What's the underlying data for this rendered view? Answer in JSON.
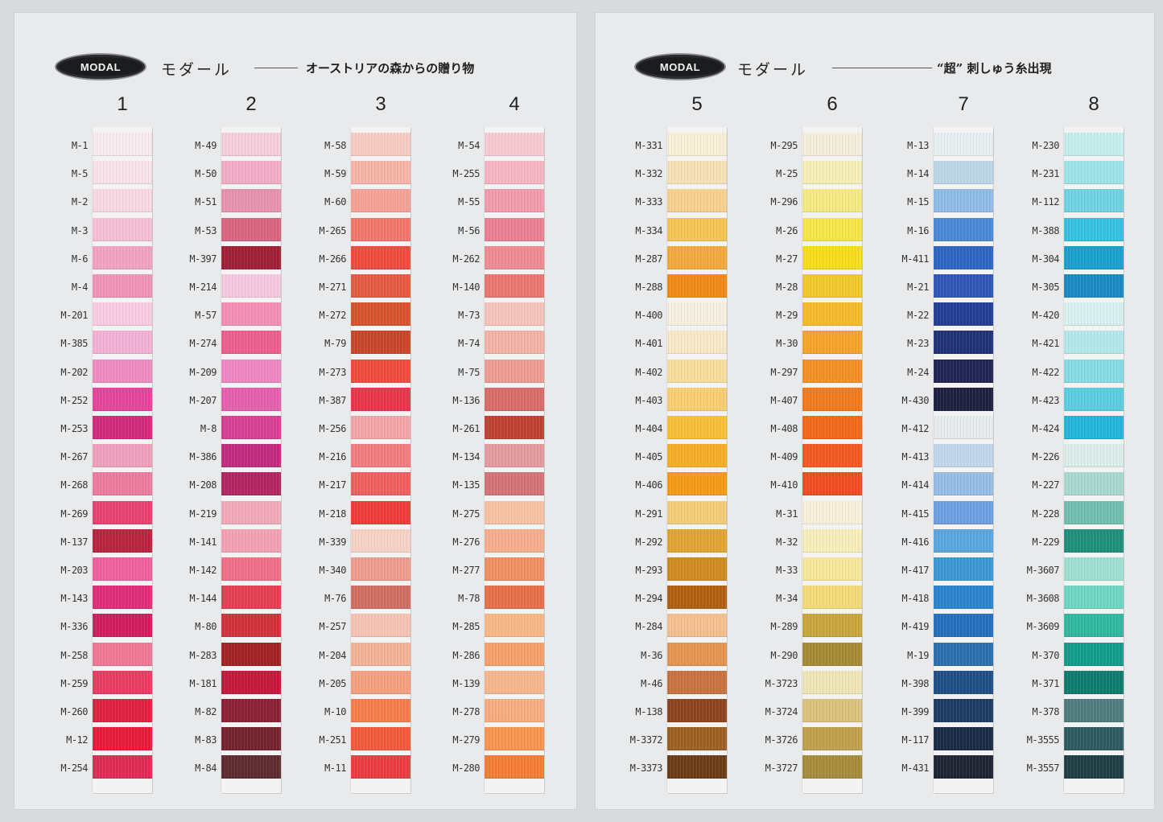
{
  "colors": {
    "page_bg": "#d9dadc",
    "card_bg": "#e9eaeb",
    "logo_bg": "#1b1c1e"
  },
  "cards": [
    {
      "logo": "MODAL",
      "brand": "モダール",
      "tagline": "オーストリアの森からの贈り物",
      "columns": [
        {
          "number": "1",
          "codes": [
            "M-1",
            "M-5",
            "M-2",
            "M-3",
            "M-6",
            "M-4",
            "M-201",
            "M-385",
            "M-202",
            "M-252",
            "M-253",
            "M-267",
            "M-268",
            "M-269",
            "M-137",
            "M-203",
            "M-143",
            "M-336",
            "M-258",
            "M-259",
            "M-260",
            "M-12",
            "M-254"
          ],
          "colors": [
            "#f7ebee",
            "#f7e3e9",
            "#f9d9e4",
            "#f7c0d6",
            "#f2a3c1",
            "#f094b8",
            "#f8cde2",
            "#f3b1d6",
            "#ef8cc2",
            "#e6449b",
            "#d22b7b",
            "#f1a0bd",
            "#ee7ba0",
            "#e6426f",
            "#b8243d",
            "#f0609d",
            "#e02e79",
            "#d31c5d",
            "#f07896",
            "#ea3b62",
            "#e0213f",
            "#e81a3a",
            "#e12a55"
          ]
        },
        {
          "number": "2",
          "codes": [
            "M-49",
            "M-50",
            "M-51",
            "M-53",
            "M-397",
            "M-214",
            "M-57",
            "M-274",
            "M-209",
            "M-207",
            "M-8",
            "M-386",
            "M-208",
            "M-219",
            "M-141",
            "M-142",
            "M-144",
            "M-80",
            "M-283",
            "M-181",
            "M-82",
            "M-83",
            "M-84"
          ],
          "colors": [
            "#f6cfdc",
            "#f2adc6",
            "#e793b0",
            "#d8647f",
            "#a01f36",
            "#f7c8e0",
            "#f48fb6",
            "#ec5e8d",
            "#ef87c2",
            "#e760ae",
            "#d63f94",
            "#c02b7e",
            "#b22462",
            "#f2aab9",
            "#f4a0b4",
            "#ef6f88",
            "#e53e52",
            "#d2313b",
            "#a32122",
            "#c4183a",
            "#8a1f34",
            "#74232e",
            "#5e2a2e"
          ]
        },
        {
          "number": "3",
          "codes": [
            "M-58",
            "M-59",
            "M-60",
            "M-265",
            "M-266",
            "M-271",
            "M-272",
            "M-79",
            "M-273",
            "M-387",
            "M-256",
            "M-216",
            "M-217",
            "M-218",
            "M-339",
            "M-340",
            "M-76",
            "M-257",
            "M-204",
            "M-205",
            "M-10",
            "M-251",
            "M-11"
          ],
          "colors": [
            "#f9ccc2",
            "#f8b5a7",
            "#f6a195",
            "#f2766a",
            "#ef4b3d",
            "#e35c42",
            "#d8542f",
            "#c8462a",
            "#ef4d3b",
            "#e9344a",
            "#f4a6a7",
            "#f27c7f",
            "#ef5f5f",
            "#f23a38",
            "#f7d3c6",
            "#ee9c8c",
            "#cf6e60",
            "#f7c3b2",
            "#f6b397",
            "#f5a07e",
            "#f77c4a",
            "#f25b3a",
            "#ee3b40"
          ]
        },
        {
          "number": "4",
          "codes": [
            "M-54",
            "M-255",
            "M-55",
            "M-56",
            "M-262",
            "M-140",
            "M-73",
            "M-74",
            "M-75",
            "M-136",
            "M-261",
            "M-134",
            "M-135",
            "M-275",
            "M-276",
            "M-277",
            "M-78",
            "M-285",
            "M-286",
            "M-139",
            "M-278",
            "M-279",
            "M-280"
          ],
          "colors": [
            "#f8cbd4",
            "#f6b4c4",
            "#f29cad",
            "#ec7f94",
            "#ef8b93",
            "#ea7671",
            "#f7c4bd",
            "#f4b2a8",
            "#ee9d95",
            "#d86c68",
            "#c04032",
            "#e49ba0",
            "#d47479",
            "#f8c1a3",
            "#f7ad8e",
            "#ef8f62",
            "#e5704a",
            "#f8b886",
            "#f7a16a",
            "#f6b68e",
            "#f8ad80",
            "#f9954f",
            "#f57d33"
          ]
        }
      ]
    },
    {
      "logo": "MODAL",
      "brand": "モダール",
      "tagline": "“超” 刺しゅう糸出現",
      "columns": [
        {
          "number": "5",
          "codes": [
            "M-331",
            "M-332",
            "M-333",
            "M-334",
            "M-287",
            "M-288",
            "M-400",
            "M-401",
            "M-402",
            "M-403",
            "M-404",
            "M-405",
            "M-406",
            "M-291",
            "M-292",
            "M-293",
            "M-294",
            "M-284",
            "M-36",
            "M-46",
            "M-138",
            "M-3372",
            "M-3373"
          ],
          "colors": [
            "#f8efd6",
            "#f7e2b7",
            "#f8d18f",
            "#f7c456",
            "#f4a93c",
            "#f08b18",
            "#f6f0e1",
            "#f8eac8",
            "#f8de9d",
            "#f8ce72",
            "#f9c037",
            "#f7ad26",
            "#f59a17",
            "#f3cc77",
            "#e2a533",
            "#d08a22",
            "#b35f10",
            "#f5c08f",
            "#e69452",
            "#c8723f",
            "#8e431f",
            "#9c6023",
            "#6b3b14"
          ]
        },
        {
          "number": "6",
          "codes": [
            "M-295",
            "M-25",
            "M-296",
            "M-26",
            "M-27",
            "M-28",
            "M-29",
            "M-30",
            "M-297",
            "M-407",
            "M-408",
            "M-409",
            "M-410",
            "M-31",
            "M-32",
            "M-33",
            "M-34",
            "M-289",
            "M-290",
            "M-3723",
            "M-3724",
            "M-3726",
            "M-3727"
          ],
          "colors": [
            "#f4eedc",
            "#f6efb8",
            "#f7ea81",
            "#f7e549",
            "#f7dd1c",
            "#f2c92a",
            "#f6ba2a",
            "#f7a42a",
            "#f49025",
            "#f27b1d",
            "#f3681b",
            "#f35820",
            "#f24c22",
            "#f8f0da",
            "#f8eeba",
            "#f7e89b",
            "#f3db78",
            "#c9a63c",
            "#a78b34",
            "#f1e6b6",
            "#dbc27d",
            "#c1a04e",
            "#a68c3a"
          ]
        },
        {
          "number": "7",
          "codes": [
            "M-13",
            "M-14",
            "M-15",
            "M-16",
            "M-411",
            "M-21",
            "M-22",
            "M-23",
            "M-24",
            "M-430",
            "M-412",
            "M-413",
            "M-414",
            "M-415",
            "M-416",
            "M-417",
            "M-418",
            "M-419",
            "M-19",
            "M-398",
            "M-399",
            "M-117",
            "M-431"
          ],
          "colors": [
            "#e8eff2",
            "#bcd6e8",
            "#90bde8",
            "#4b88d6",
            "#2e65c4",
            "#2e56b3",
            "#233e95",
            "#203178",
            "#1f2452",
            "#1e2040",
            "#e7ecef",
            "#c2d7ec",
            "#96bde6",
            "#6c9fdf",
            "#5aa6e1",
            "#3c97d5",
            "#2b82cd",
            "#236fbb",
            "#2c6fae",
            "#1f4f86",
            "#1c3b63",
            "#1a2a45",
            "#1d2433"
          ]
        },
        {
          "number": "8",
          "codes": [
            "M-230",
            "M-231",
            "M-112",
            "M-388",
            "M-304",
            "M-305",
            "M-420",
            "M-421",
            "M-422",
            "M-423",
            "M-424",
            "M-226",
            "M-227",
            "M-228",
            "M-229",
            "M-3607",
            "M-3608",
            "M-3609",
            "M-370",
            "M-371",
            "M-378",
            "M-3555",
            "M-3557"
          ],
          "colors": [
            "#c6eeed",
            "#9fe3ea",
            "#6fd3e4",
            "#35c1e0",
            "#17a1cc",
            "#1b89c2",
            "#d8f1ef",
            "#b3e8ec",
            "#86dbe6",
            "#5acde0",
            "#22b7da",
            "#dbeeea",
            "#a9d8cf",
            "#72bfb0",
            "#1f8f7c",
            "#9fe0d2",
            "#6fd6c2",
            "#2fb9a0",
            "#129d8a",
            "#0e7b6f",
            "#4e7c7e",
            "#2e5a60",
            "#1f3d44"
          ]
        }
      ]
    }
  ]
}
